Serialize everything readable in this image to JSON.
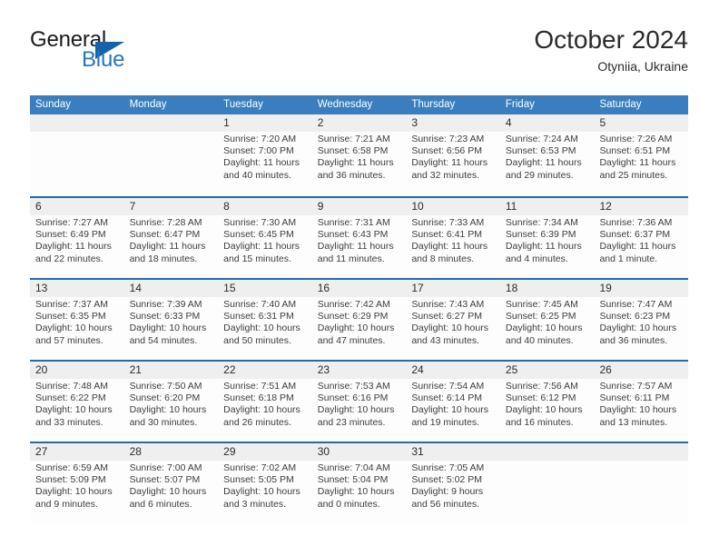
{
  "brand": {
    "name_part1": "General",
    "name_part2": "Blue",
    "logo_icon": "triangle-logo-icon"
  },
  "header": {
    "title": "October 2024",
    "location": "Otyniia, Ukraine"
  },
  "colors": {
    "header_blue": "#3a7ebf",
    "row_rule_blue": "#1f6cb0",
    "band_gray": "#efefef",
    "brand_blue": "#2676c0",
    "text": "#2b2b2b"
  },
  "calendar": {
    "weekdays": [
      "Sunday",
      "Monday",
      "Tuesday",
      "Wednesday",
      "Thursday",
      "Friday",
      "Saturday"
    ],
    "weeks": [
      [
        {
          "day": "",
          "sunrise": "",
          "sunset": "",
          "daylight": "",
          "empty": true
        },
        {
          "day": "",
          "sunrise": "",
          "sunset": "",
          "daylight": "",
          "empty": true
        },
        {
          "day": "1",
          "sunrise": "Sunrise: 7:20 AM",
          "sunset": "Sunset: 7:00 PM",
          "daylight": "Daylight: 11 hours and 40 minutes."
        },
        {
          "day": "2",
          "sunrise": "Sunrise: 7:21 AM",
          "sunset": "Sunset: 6:58 PM",
          "daylight": "Daylight: 11 hours and 36 minutes."
        },
        {
          "day": "3",
          "sunrise": "Sunrise: 7:23 AM",
          "sunset": "Sunset: 6:56 PM",
          "daylight": "Daylight: 11 hours and 32 minutes."
        },
        {
          "day": "4",
          "sunrise": "Sunrise: 7:24 AM",
          "sunset": "Sunset: 6:53 PM",
          "daylight": "Daylight: 11 hours and 29 minutes."
        },
        {
          "day": "5",
          "sunrise": "Sunrise: 7:26 AM",
          "sunset": "Sunset: 6:51 PM",
          "daylight": "Daylight: 11 hours and 25 minutes."
        }
      ],
      [
        {
          "day": "6",
          "sunrise": "Sunrise: 7:27 AM",
          "sunset": "Sunset: 6:49 PM",
          "daylight": "Daylight: 11 hours and 22 minutes."
        },
        {
          "day": "7",
          "sunrise": "Sunrise: 7:28 AM",
          "sunset": "Sunset: 6:47 PM",
          "daylight": "Daylight: 11 hours and 18 minutes."
        },
        {
          "day": "8",
          "sunrise": "Sunrise: 7:30 AM",
          "sunset": "Sunset: 6:45 PM",
          "daylight": "Daylight: 11 hours and 15 minutes."
        },
        {
          "day": "9",
          "sunrise": "Sunrise: 7:31 AM",
          "sunset": "Sunset: 6:43 PM",
          "daylight": "Daylight: 11 hours and 11 minutes."
        },
        {
          "day": "10",
          "sunrise": "Sunrise: 7:33 AM",
          "sunset": "Sunset: 6:41 PM",
          "daylight": "Daylight: 11 hours and 8 minutes."
        },
        {
          "day": "11",
          "sunrise": "Sunrise: 7:34 AM",
          "sunset": "Sunset: 6:39 PM",
          "daylight": "Daylight: 11 hours and 4 minutes."
        },
        {
          "day": "12",
          "sunrise": "Sunrise: 7:36 AM",
          "sunset": "Sunset: 6:37 PM",
          "daylight": "Daylight: 11 hours and 1 minute."
        }
      ],
      [
        {
          "day": "13",
          "sunrise": "Sunrise: 7:37 AM",
          "sunset": "Sunset: 6:35 PM",
          "daylight": "Daylight: 10 hours and 57 minutes."
        },
        {
          "day": "14",
          "sunrise": "Sunrise: 7:39 AM",
          "sunset": "Sunset: 6:33 PM",
          "daylight": "Daylight: 10 hours and 54 minutes."
        },
        {
          "day": "15",
          "sunrise": "Sunrise: 7:40 AM",
          "sunset": "Sunset: 6:31 PM",
          "daylight": "Daylight: 10 hours and 50 minutes."
        },
        {
          "day": "16",
          "sunrise": "Sunrise: 7:42 AM",
          "sunset": "Sunset: 6:29 PM",
          "daylight": "Daylight: 10 hours and 47 minutes."
        },
        {
          "day": "17",
          "sunrise": "Sunrise: 7:43 AM",
          "sunset": "Sunset: 6:27 PM",
          "daylight": "Daylight: 10 hours and 43 minutes."
        },
        {
          "day": "18",
          "sunrise": "Sunrise: 7:45 AM",
          "sunset": "Sunset: 6:25 PM",
          "daylight": "Daylight: 10 hours and 40 minutes."
        },
        {
          "day": "19",
          "sunrise": "Sunrise: 7:47 AM",
          "sunset": "Sunset: 6:23 PM",
          "daylight": "Daylight: 10 hours and 36 minutes."
        }
      ],
      [
        {
          "day": "20",
          "sunrise": "Sunrise: 7:48 AM",
          "sunset": "Sunset: 6:22 PM",
          "daylight": "Daylight: 10 hours and 33 minutes."
        },
        {
          "day": "21",
          "sunrise": "Sunrise: 7:50 AM",
          "sunset": "Sunset: 6:20 PM",
          "daylight": "Daylight: 10 hours and 30 minutes."
        },
        {
          "day": "22",
          "sunrise": "Sunrise: 7:51 AM",
          "sunset": "Sunset: 6:18 PM",
          "daylight": "Daylight: 10 hours and 26 minutes."
        },
        {
          "day": "23",
          "sunrise": "Sunrise: 7:53 AM",
          "sunset": "Sunset: 6:16 PM",
          "daylight": "Daylight: 10 hours and 23 minutes."
        },
        {
          "day": "24",
          "sunrise": "Sunrise: 7:54 AM",
          "sunset": "Sunset: 6:14 PM",
          "daylight": "Daylight: 10 hours and 19 minutes."
        },
        {
          "day": "25",
          "sunrise": "Sunrise: 7:56 AM",
          "sunset": "Sunset: 6:12 PM",
          "daylight": "Daylight: 10 hours and 16 minutes."
        },
        {
          "day": "26",
          "sunrise": "Sunrise: 7:57 AM",
          "sunset": "Sunset: 6:11 PM",
          "daylight": "Daylight: 10 hours and 13 minutes."
        }
      ],
      [
        {
          "day": "27",
          "sunrise": "Sunrise: 6:59 AM",
          "sunset": "Sunset: 5:09 PM",
          "daylight": "Daylight: 10 hours and 9 minutes."
        },
        {
          "day": "28",
          "sunrise": "Sunrise: 7:00 AM",
          "sunset": "Sunset: 5:07 PM",
          "daylight": "Daylight: 10 hours and 6 minutes."
        },
        {
          "day": "29",
          "sunrise": "Sunrise: 7:02 AM",
          "sunset": "Sunset: 5:05 PM",
          "daylight": "Daylight: 10 hours and 3 minutes."
        },
        {
          "day": "30",
          "sunrise": "Sunrise: 7:04 AM",
          "sunset": "Sunset: 5:04 PM",
          "daylight": "Daylight: 10 hours and 0 minutes."
        },
        {
          "day": "31",
          "sunrise": "Sunrise: 7:05 AM",
          "sunset": "Sunset: 5:02 PM",
          "daylight": "Daylight: 9 hours and 56 minutes."
        },
        {
          "day": "",
          "sunrise": "",
          "sunset": "",
          "daylight": "",
          "empty": true
        },
        {
          "day": "",
          "sunrise": "",
          "sunset": "",
          "daylight": "",
          "empty": true
        }
      ]
    ]
  }
}
